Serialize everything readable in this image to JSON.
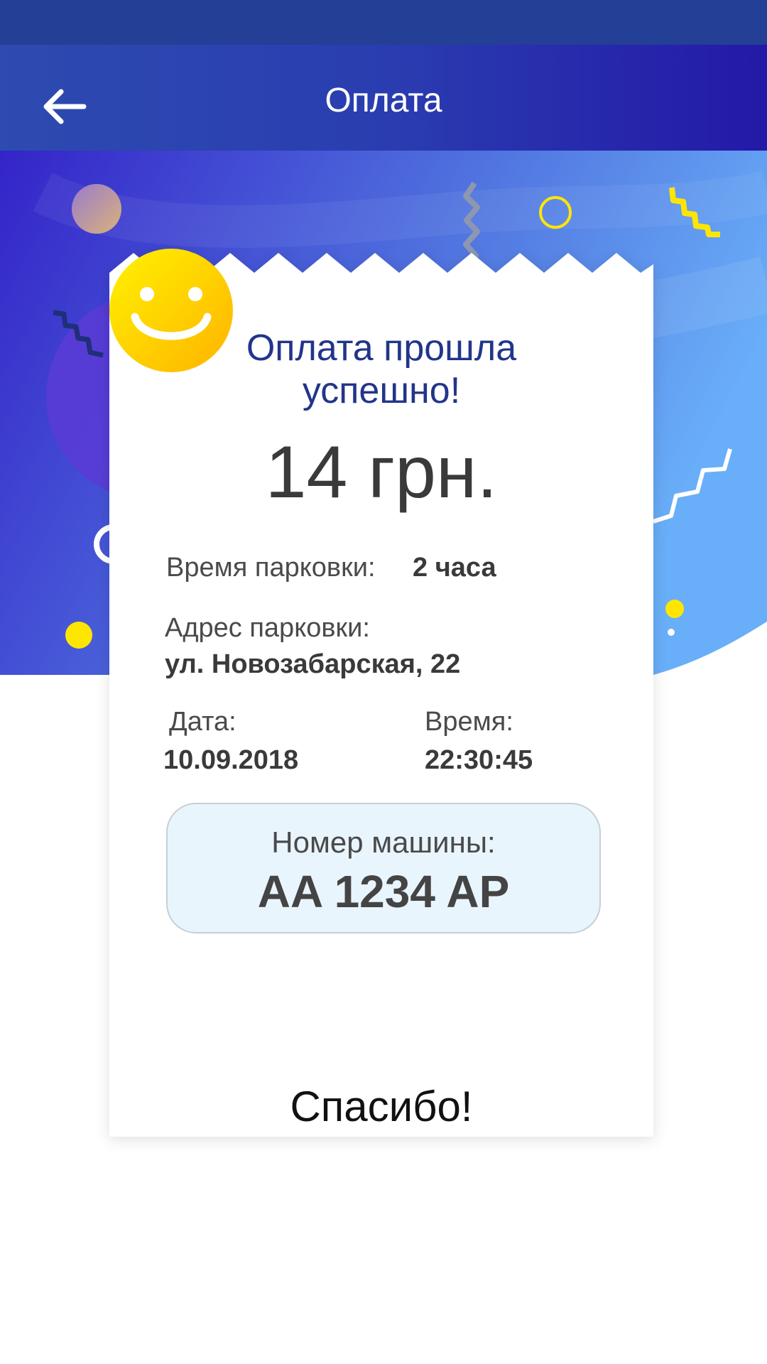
{
  "app_bar": {
    "title": "Оплата",
    "back_icon": "arrow-left-icon"
  },
  "receipt": {
    "success_title_line1": "Оплата прошла",
    "success_title_line2": "успешно!",
    "amount": "14 грн.",
    "parking_time_label": "Время парковки:",
    "parking_time_value": "2 часа",
    "address_label": "Адрес парковки:",
    "address_value": "ул. Новозабарская, 22",
    "date_label": "Дата:",
    "date_value": "10.09.2018",
    "time_label": "Время:",
    "time_value": "22:30:45",
    "plate_label": "Номер машины:",
    "plate_value": "AA 1234 AP",
    "smiley_icon": "smiley-face-icon",
    "thanks": "Спасибо!"
  },
  "colors": {
    "status_bar": "#243f96",
    "app_bar": "#2a3db0",
    "title_blue": "#22358a",
    "plate_bg": "#e9f5fd",
    "accent_yellow": "#ffe600"
  }
}
